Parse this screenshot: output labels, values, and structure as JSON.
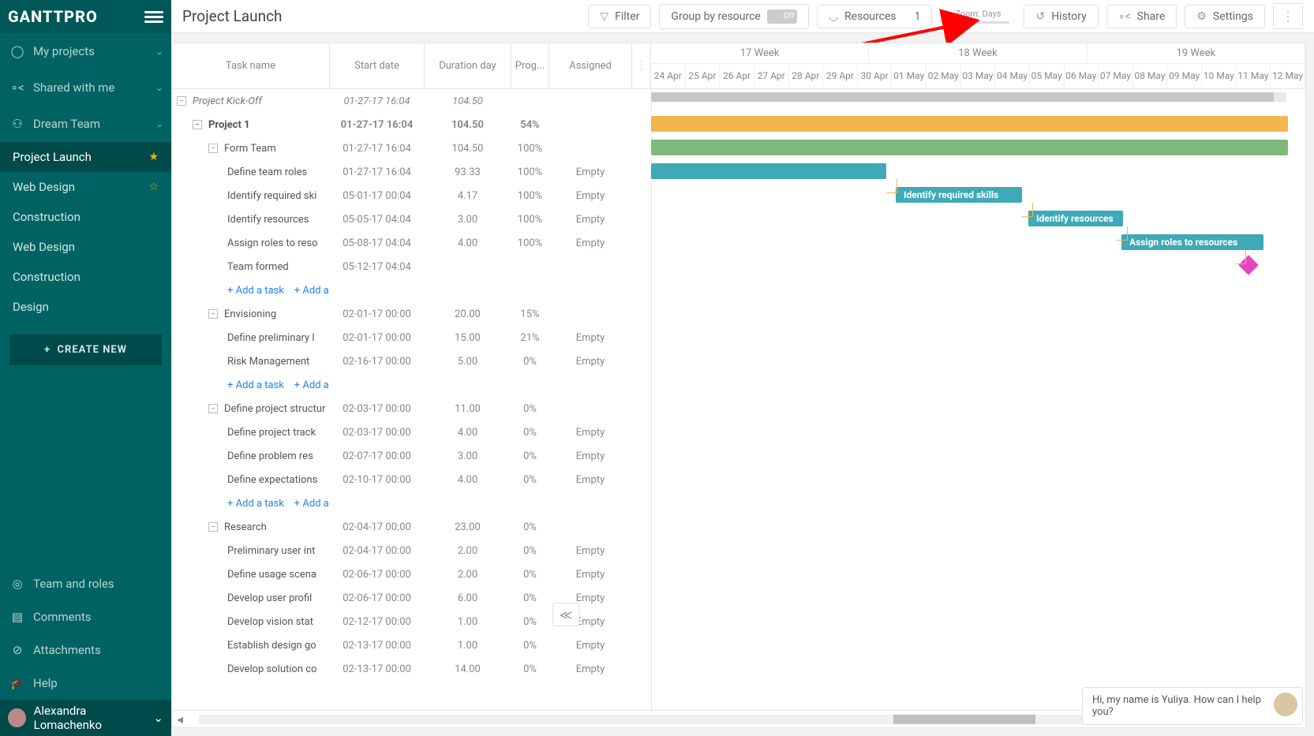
{
  "app": {
    "logo": "GANTTPRO"
  },
  "nav": {
    "my_projects": "My projects",
    "shared": "Shared with me",
    "dream_team": "Dream Team",
    "team_roles": "Team and roles",
    "comments": "Comments",
    "attachments": "Attachments",
    "help": "Help"
  },
  "projects": [
    {
      "name": "Project Launch",
      "star": "gold",
      "active": true
    },
    {
      "name": "Web Design",
      "star": "outline"
    },
    {
      "name": "Construction"
    },
    {
      "name": "Web Design"
    },
    {
      "name": "Construction"
    },
    {
      "name": "Design"
    }
  ],
  "create_btn": "CREATE NEW",
  "user": {
    "name": "Alexandra Lomachenko"
  },
  "header": {
    "title": "Project Launch",
    "filter": "Filter",
    "group": "Group by resource",
    "off": "Off",
    "resources": "Resources",
    "resources_count": "1",
    "zoom_label": "Zoom: Days",
    "history": "History",
    "share": "Share",
    "settings": "Settings"
  },
  "columns": {
    "task": "Task name",
    "start": "Start date",
    "duration": "Duration day",
    "progress": "Prog...",
    "assigned": "Assigned"
  },
  "timeline": {
    "weeks": [
      "17 Week",
      "18 Week",
      "19 Week"
    ],
    "days": [
      "24 Apr",
      "25 Apr",
      "26 Apr",
      "27 Apr",
      "28 Apr",
      "29 Apr",
      "30 Apr",
      "01 May",
      "02 May",
      "03 May",
      "04 May",
      "05 May",
      "06 May",
      "07 May",
      "08 May",
      "09 May",
      "10 May",
      "11 May",
      "12 May"
    ]
  },
  "tasks": [
    {
      "name": "Project Kick-Off",
      "start": "01-27-17 16:04",
      "dur": "104.50",
      "prog": "",
      "assign": "",
      "indent": 0,
      "italic": true,
      "collapse": true
    },
    {
      "name": "Project 1",
      "start": "01-27-17 16:04",
      "dur": "104.50",
      "prog": "54%",
      "assign": "",
      "indent": 1,
      "bold": true,
      "collapse": true
    },
    {
      "name": "Form Team",
      "start": "01-27-17 16:04",
      "dur": "104.50",
      "prog": "100%",
      "assign": "",
      "indent": 2,
      "collapse": true
    },
    {
      "name": "Define team roles",
      "start": "01-27-17 16:04",
      "dur": "93.33",
      "prog": "100%",
      "assign": "Empty",
      "indent": 3
    },
    {
      "name": "Identify required ski",
      "start": "05-01-17 00:04",
      "dur": "4.17",
      "prog": "100%",
      "assign": "Empty",
      "indent": 3
    },
    {
      "name": "Identify resources",
      "start": "05-05-17 04:04",
      "dur": "3.00",
      "prog": "100%",
      "assign": "Empty",
      "indent": 3
    },
    {
      "name": "Assign roles to reso",
      "start": "05-08-17 04:04",
      "dur": "4.00",
      "prog": "100%",
      "assign": "Empty",
      "indent": 3
    },
    {
      "name": "Team formed",
      "start": "05-12-17 04:04",
      "dur": "",
      "prog": "",
      "assign": "",
      "indent": 3
    },
    {
      "addrow": true,
      "indent": 3
    },
    {
      "name": "Envisioning",
      "start": "02-01-17 00:00",
      "dur": "20.00",
      "prog": "15%",
      "assign": "",
      "indent": 2,
      "collapse": true
    },
    {
      "name": "Define preliminary l",
      "start": "02-01-17 00:00",
      "dur": "15.00",
      "prog": "21%",
      "assign": "Empty",
      "indent": 3
    },
    {
      "name": "Risk Management",
      "start": "02-16-17 00:00",
      "dur": "5.00",
      "prog": "0%",
      "assign": "Empty",
      "indent": 3
    },
    {
      "addrow": true,
      "indent": 3
    },
    {
      "name": "Define project structur",
      "start": "02-03-17 00:00",
      "dur": "11.00",
      "prog": "0%",
      "assign": "",
      "indent": 2,
      "collapse": true
    },
    {
      "name": "Define project track",
      "start": "02-03-17 00:00",
      "dur": "4.00",
      "prog": "0%",
      "assign": "Empty",
      "indent": 3
    },
    {
      "name": "Define problem res",
      "start": "02-07-17 00:00",
      "dur": "3.00",
      "prog": "0%",
      "assign": "Empty",
      "indent": 3
    },
    {
      "name": "Define expectations",
      "start": "02-10-17 00:00",
      "dur": "4.00",
      "prog": "0%",
      "assign": "Empty",
      "indent": 3
    },
    {
      "addrow": true,
      "indent": 3
    },
    {
      "name": "Research",
      "start": "02-04-17 00:00",
      "dur": "23.00",
      "prog": "0%",
      "assign": "",
      "indent": 2,
      "collapse": true
    },
    {
      "name": "Preliminary user int",
      "start": "02-04-17 00:00",
      "dur": "2.00",
      "prog": "0%",
      "assign": "Empty",
      "indent": 3
    },
    {
      "name": "Define usage scena",
      "start": "02-06-17 00:00",
      "dur": "2.00",
      "prog": "0%",
      "assign": "Empty",
      "indent": 3
    },
    {
      "name": "Develop user profil",
      "start": "02-06-17 00:00",
      "dur": "6.00",
      "prog": "0%",
      "assign": "Empty",
      "indent": 3
    },
    {
      "name": "Develop vision stat",
      "start": "02-12-17 00:00",
      "dur": "1.00",
      "prog": "0%",
      "assign": "Empty",
      "indent": 3
    },
    {
      "name": "Establish design go",
      "start": "02-13-17 00:00",
      "dur": "1.00",
      "prog": "0%",
      "assign": "Empty",
      "indent": 3
    },
    {
      "name": "Develop solution co",
      "start": "02-13-17 00:00",
      "dur": "14.00",
      "prog": "0%",
      "assign": "Empty",
      "indent": 3
    }
  ],
  "add_task": "+ Add a task",
  "add_milestone": "+ Add a milestone",
  "bars": {
    "skills": "Identify required skills",
    "resources": "Identify resources",
    "assign": "Assign roles to resources"
  },
  "chat": {
    "msg": "Hi, my name is Yuliya. How can I help you?"
  }
}
